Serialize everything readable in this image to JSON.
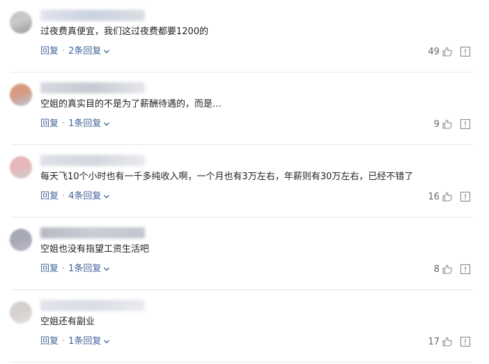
{
  "comments": [
    {
      "text": "过夜费真便宜，我们这过夜费都要1200的",
      "reply_label": "回复",
      "separator": "·",
      "replies_label": "2条回复",
      "likes": "49",
      "avatar_colors": [
        "#c8c8c8",
        "#9a9a9a"
      ],
      "username_colors": [
        "#d6dbe6",
        "#b9c3d6",
        "#cfd3da"
      ]
    },
    {
      "text": "空姐的真实目的不是为了薪酬待遇的，而是…",
      "reply_label": "回复",
      "separator": "·",
      "replies_label": "1条回复",
      "likes": "9",
      "avatar_colors": [
        "#d89a83",
        "#b8c7d8"
      ],
      "username_colors": [
        "#c8ccd4",
        "#b3b8c2",
        "#dcdfe4"
      ]
    },
    {
      "text": "每天飞10个小时也有一千多纯收入啊，一个月也有3万左右，年薪则有30万左右，已经不错了",
      "reply_label": "回复",
      "separator": "·",
      "replies_label": "4条回复",
      "likes": "16",
      "avatar_colors": [
        "#e6b6ba",
        "#cfcfcf"
      ],
      "username_colors": [
        "#d3d7df",
        "#c4c9d3",
        "#e2e4e8"
      ]
    },
    {
      "text": "空姐也没有指望工资生活吧",
      "reply_label": "回复",
      "separator": "·",
      "replies_label": "1条回复",
      "likes": "8",
      "avatar_colors": [
        "#a5a9b4",
        "#c2b8c8"
      ],
      "username_colors": [
        "#9ea3ad",
        "#b7bcc6",
        "#aeb3bd"
      ]
    },
    {
      "text": "空姐还有副业",
      "reply_label": "回复",
      "separator": "·",
      "replies_label": "1条回复",
      "likes": "17",
      "avatar_colors": [
        "#d7d1cd",
        "#e5e0dc"
      ],
      "username_colors": [
        "#d8dce4",
        "#cdd2dc",
        "#e3e5ea"
      ]
    }
  ],
  "colors": {
    "link": "#406599",
    "text": "#222222",
    "muted": "#999999",
    "divider": "#e8e8e8"
  },
  "icons": {
    "like": "thumbs-up-icon",
    "report": "report-icon",
    "expand": "chevron-down-icon"
  }
}
